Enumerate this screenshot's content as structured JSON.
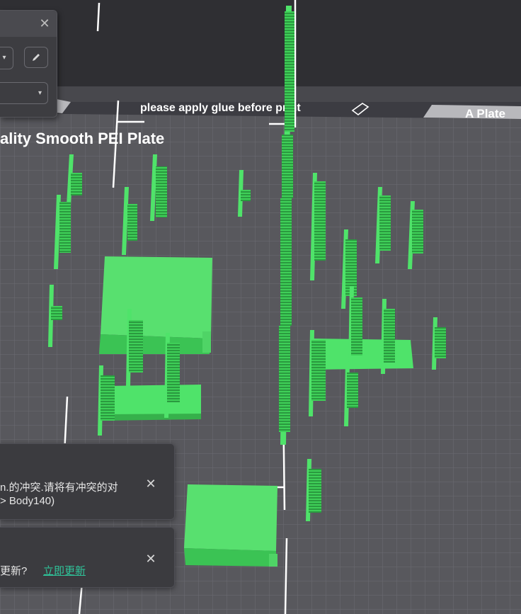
{
  "plate": {
    "label_text": "please apply glue before print",
    "title_text": "ality Smooth PEI Plate",
    "tab_label": "A Plate"
  },
  "settings_panel": {
    "close_glyph": "✕",
    "dropdown_glyph": "▾"
  },
  "notifications": [
    {
      "line1": "n.的冲突.请将有冲突的对",
      "line2": "> Body140)",
      "close_glyph": "✕"
    },
    {
      "text": "更新?",
      "link_label": "立即更新",
      "close_glyph": "✕"
    }
  ],
  "colors": {
    "background": "#3c3c42",
    "bed": "#57575c",
    "grid": "#6a6a70",
    "model": "#4fe36a",
    "link": "#2fc49a"
  }
}
